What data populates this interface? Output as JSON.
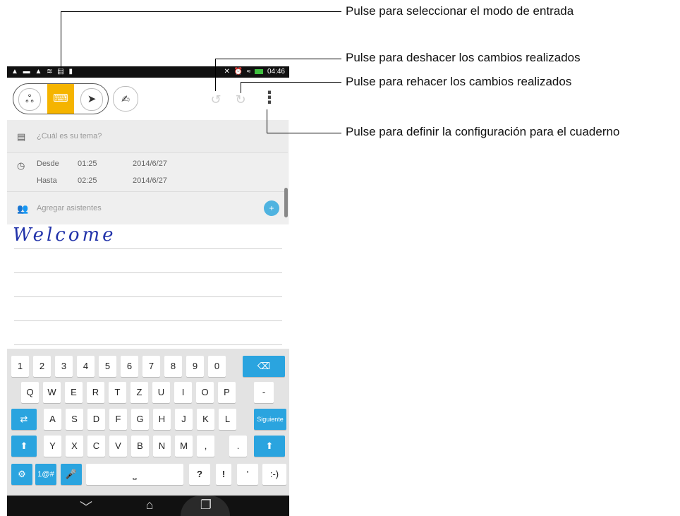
{
  "status_bar": {
    "left_icons": [
      "alert-icon",
      "message-icon",
      "alert-icon",
      "mail-icon",
      "sd-icon",
      "file-icon"
    ],
    "time": "04:46"
  },
  "toolbar": {
    "modes": [
      {
        "name": "handwriting-mode",
        "glyph": "ஃ"
      },
      {
        "name": "keyboard-mode",
        "glyph": "⌨",
        "active": true
      },
      {
        "name": "doodle-mode",
        "glyph": "➤"
      }
    ],
    "pen_glyph": "✍",
    "undo_glyph": "↺",
    "redo_glyph": "↻",
    "menu_glyph": "⋮"
  },
  "event": {
    "topic_placeholder": "¿Cuál es su tema?",
    "from_label": "Desde",
    "from_time": "01:25",
    "from_date": "2014/6/27",
    "to_label": "Hasta",
    "to_time": "02:25",
    "to_date": "2014/6/27",
    "attendees_placeholder": "Agregar asistentes"
  },
  "note": {
    "handwritten_text": "Welcome"
  },
  "keyboard": {
    "row1": [
      "1",
      "2",
      "3",
      "4",
      "5",
      "6",
      "7",
      "8",
      "9",
      "0"
    ],
    "backspace": "⌫",
    "row2": [
      "Q",
      "W",
      "E",
      "R",
      "T",
      "Z",
      "U",
      "I",
      "O",
      "P",
      "-"
    ],
    "tab": "⇄",
    "row3": [
      "A",
      "S",
      "D",
      "F",
      "G",
      "H",
      "J",
      "K",
      "L"
    ],
    "next": "Siguiente",
    "shift": "⬆",
    "row4": [
      "Y",
      "X",
      "C",
      "V",
      "B",
      "N",
      "M",
      ",",
      "."
    ],
    "settings": "⚙",
    "symbols": "1@#",
    "mic": "🎤",
    "space": "⎵",
    "row5_right": [
      "?",
      "!",
      "'",
      ":-)"
    ]
  },
  "navbar": {
    "back": "﹀",
    "home": "⌂",
    "recent": "❐"
  },
  "callouts": {
    "input_mode": "Pulse para seleccionar el modo de entrada",
    "undo": "Pulse para deshacer los cambios realizados",
    "redo": "Pulse para rehacer los cambios realizados",
    "settings": "Pulse para definir la configuración para el cuaderno"
  },
  "colors": {
    "accent_yellow": "#f5b400",
    "key_blue": "#2aa4df",
    "ink_blue": "#2233aa"
  }
}
